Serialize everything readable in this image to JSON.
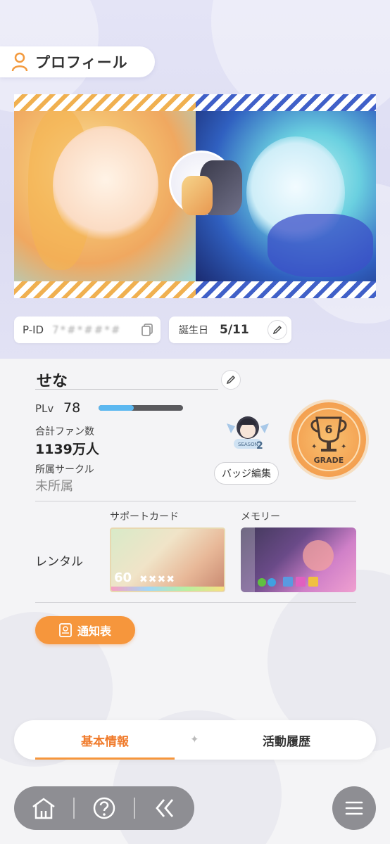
{
  "header": {
    "title": "プロフィール",
    "icon": "person-icon"
  },
  "profile": {
    "pid_label": "P-ID",
    "pid_value": "7*#*##*#",
    "birthday_label": "誕生日",
    "birthday_value": "5/11",
    "name": "せな",
    "plv_label": "PLv",
    "plv_value": "78",
    "plv_progress": 0.42,
    "fans_label": "合計ファン数",
    "fans_value": "1139万人",
    "circle_label": "所属サークル",
    "circle_value": "未所属"
  },
  "badges": {
    "season_text": "SEASON",
    "season_number": "2",
    "badge_edit_label": "バッジ編集",
    "grade_number": "6",
    "grade_text": "GRADE"
  },
  "rental": {
    "label": "レンタル",
    "support_label": "サポートカード",
    "memory_label": "メモリー",
    "support_level": "60",
    "support_stars": "✖✖✖✖"
  },
  "report_button": {
    "label": "通知表"
  },
  "tabs": [
    {
      "label": "基本情報",
      "active": true
    },
    {
      "label": "活動履歴",
      "active": false
    }
  ],
  "nav": [
    "home-icon",
    "help-icon",
    "back-icon"
  ],
  "colors": {
    "accent": "#f6963c",
    "tab_active": "#f07a2a",
    "plv_bar": "#5cb8f0",
    "nav_bg": "#8e8e93"
  }
}
